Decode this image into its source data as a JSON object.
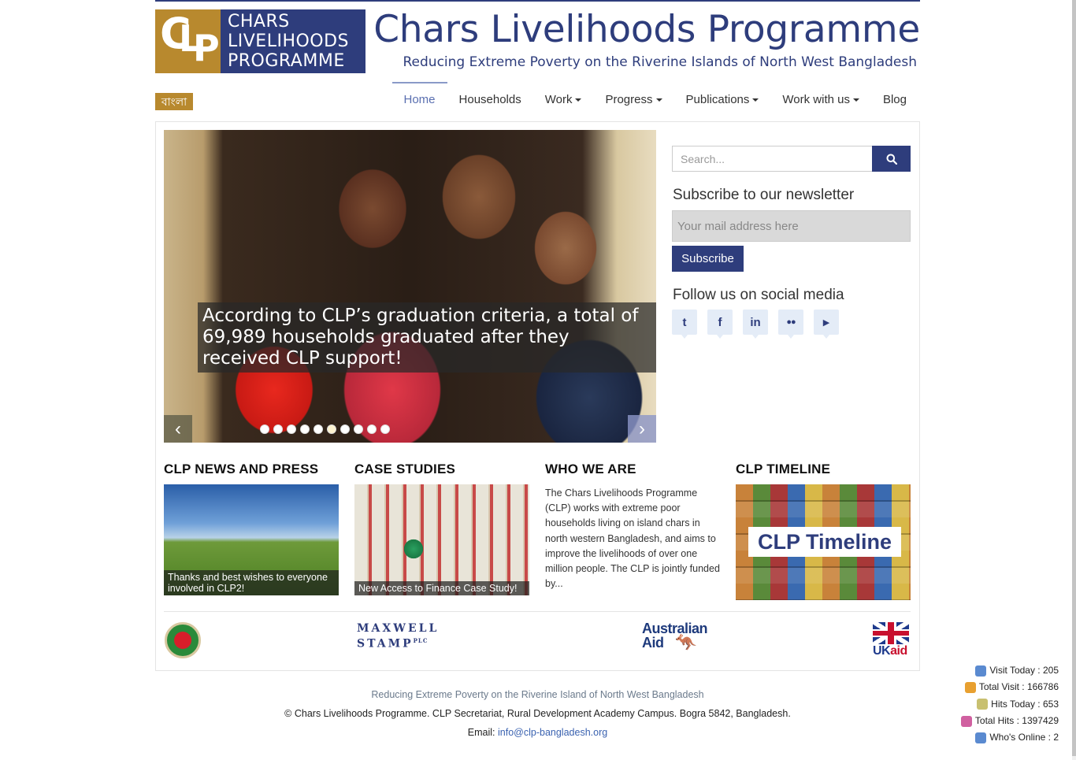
{
  "header": {
    "logo_lines": [
      "CHARS",
      "LIVELIHOODS",
      "PROGRAMME"
    ],
    "logo_mark": {
      "c": "C",
      "l": "L",
      "p": "P"
    },
    "title": "Chars Livelihoods Programme",
    "subtitle": "Reducing Extreme Poverty on the Riverine Islands of North West Bangladesh",
    "language_button": "বাংলা"
  },
  "nav": {
    "items": [
      {
        "label": "Home",
        "active": true,
        "dropdown": false
      },
      {
        "label": "Households",
        "active": false,
        "dropdown": false
      },
      {
        "label": "Work",
        "active": false,
        "dropdown": true
      },
      {
        "label": "Progress",
        "active": false,
        "dropdown": true
      },
      {
        "label": "Publications",
        "active": false,
        "dropdown": true
      },
      {
        "label": "Work with us",
        "active": false,
        "dropdown": true
      },
      {
        "label": "Blog",
        "active": false,
        "dropdown": false
      }
    ]
  },
  "slider": {
    "caption": "According to CLP’s graduation criteria, a total of 69,989 households graduated after they received CLP support!",
    "prev_icon": "chevron-left-icon",
    "next_icon": "chevron-right-icon",
    "dot_count": 10,
    "active_dot": 6
  },
  "sidebar": {
    "search_placeholder": "Search...",
    "newsletter_heading": "Subscribe to our newsletter",
    "mail_placeholder": "Your mail address here",
    "subscribe_label": "Subscribe",
    "social_heading": "Follow us on social media",
    "social": [
      {
        "name": "twitter-icon",
        "glyph": "t"
      },
      {
        "name": "facebook-icon",
        "glyph": "f"
      },
      {
        "name": "linkedin-icon",
        "glyph": "in"
      },
      {
        "name": "flickr-icon",
        "glyph": "●●"
      },
      {
        "name": "youtube-icon",
        "glyph": "▶"
      }
    ]
  },
  "sections": {
    "news": {
      "title": "CLP NEWS AND PRESS",
      "caption": "Thanks and best wishes to everyone involved in CLP2!"
    },
    "case": {
      "title": "CASE STUDIES",
      "caption": "New Access to Finance Case Study!"
    },
    "who": {
      "title": "WHO WE ARE",
      "text": "The Chars Livelihoods Programme (CLP) works with extreme poor households living on island chars in north western Bangladesh, and aims to improve the livelihoods of over one million people. The CLP is jointly funded by..."
    },
    "timeline": {
      "title": "CLP TIMELINE",
      "label": "CLP Timeline"
    }
  },
  "partners": {
    "maxwell_line1": "MAXWELL",
    "maxwell_line2": "STAMP",
    "maxwell_plc": "PLC",
    "aus_line1": "Australian",
    "aus_line2": "Aid",
    "ukaid_uk": "UK",
    "ukaid_aid": "aid"
  },
  "footer": {
    "tagline": "Reducing Extreme Poverty on the Riverine Island of North West Bangladesh",
    "copyright": "© Chars Livelihoods Programme. CLP Secretariat, Rural Development Academy Campus. Bogra 5842, Bangladesh.",
    "email_label": "Email:",
    "email": "info@clp-bangladesh.org"
  },
  "stats": [
    {
      "label": "Visit Today : 205",
      "icon": "visitor-icon",
      "color": "#5a8ad0"
    },
    {
      "label": "Total Visit : 166786",
      "icon": "bar-chart-icon",
      "color": "#e8a030"
    },
    {
      "label": "Hits Today : 653",
      "icon": "calendar-icon",
      "color": "#c8c070"
    },
    {
      "label": "Total Hits : 1397429",
      "icon": "bar-chart-icon",
      "color": "#d060a0"
    },
    {
      "label": "Who's Online : 2",
      "icon": "user-online-icon",
      "color": "#5a8ad0"
    }
  ]
}
